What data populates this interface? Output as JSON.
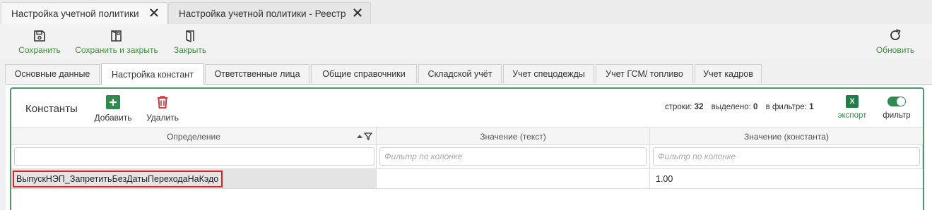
{
  "doc_tabs": [
    {
      "label": "Настройка учетной политики"
    },
    {
      "label": "Настройка учетной политики - Реестр"
    }
  ],
  "toolbar": {
    "save": "Сохранить",
    "save_close": "Сохранить и закрыть",
    "close": "Закрыть",
    "refresh": "Обновить"
  },
  "section_tabs": [
    {
      "label": "Основные данные"
    },
    {
      "label": "Настройка констант"
    },
    {
      "label": "Ответственные лица"
    },
    {
      "label": "Общие справочники"
    },
    {
      "label": "Складской учёт"
    },
    {
      "label": "Учет спецодежды"
    },
    {
      "label": "Учет ГСМ/ топливо"
    },
    {
      "label": "Учет кадров"
    }
  ],
  "active_section_tab": "Настройка констант",
  "grid": {
    "title": "Константы",
    "add": "Добавить",
    "delete": "Удалить",
    "stats": {
      "rows_label": "строки:",
      "rows": "32",
      "selected_label": "выделено:",
      "selected": "0",
      "filtered_label": "в фильтре:",
      "filtered": "1"
    },
    "export_icon_text": "X",
    "export": "экспорт",
    "filter": "фильтр",
    "filter_enabled": true,
    "columns": [
      {
        "header": "Определение"
      },
      {
        "header": "Значение (текст)"
      },
      {
        "header": "Значение (константа)"
      }
    ],
    "filter_values": [
      "",
      "",
      ""
    ],
    "filter_placeholder": "Фильтр по колонке",
    "rows": [
      {
        "definition": "ВыпускНЭП_ЗапретитьБезДатыПереходаНаКэдо",
        "value_text": "",
        "value_const": "1.00"
      }
    ]
  },
  "colors": {
    "accent_green": "#2e8b4e",
    "label_green": "#3d8f3d",
    "delete_red": "#d22",
    "highlight_border": "#d22"
  }
}
